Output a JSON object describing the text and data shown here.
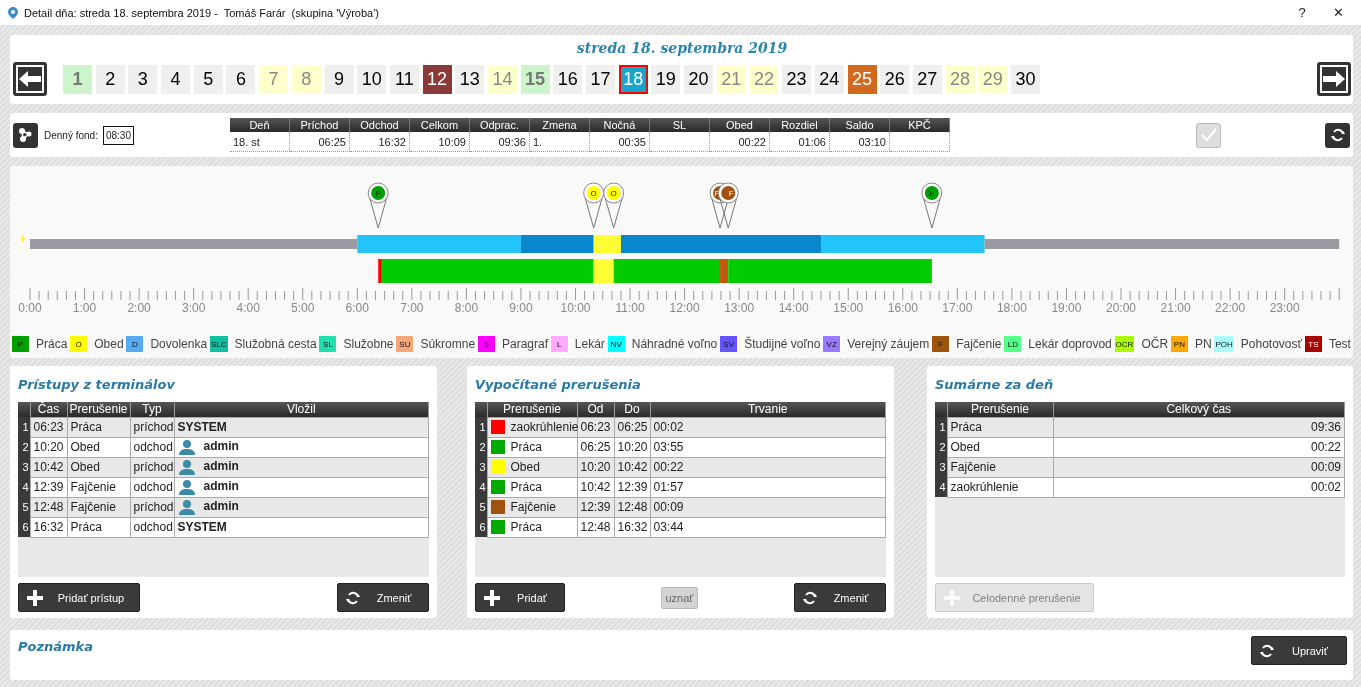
{
  "window": {
    "title": "Detail dňa: streda 18. septembra 2019 -  Tomáš Farár  (skupina 'Výroba')",
    "help": "?",
    "close": "✕"
  },
  "calendar": {
    "heading": "streda 18. septembra 2019",
    "days": [
      {
        "label": "1",
        "kind": "holiday",
        "selected": false
      },
      {
        "label": "2",
        "kind": "workday",
        "selected": false
      },
      {
        "label": "3",
        "kind": "workday",
        "selected": false
      },
      {
        "label": "4",
        "kind": "workday",
        "selected": false
      },
      {
        "label": "5",
        "kind": "workday",
        "selected": false
      },
      {
        "label": "6",
        "kind": "workday",
        "selected": false
      },
      {
        "label": "7",
        "kind": "weekend",
        "selected": false
      },
      {
        "label": "8",
        "kind": "weekend",
        "selected": false
      },
      {
        "label": "9",
        "kind": "workday",
        "selected": false
      },
      {
        "label": "10",
        "kind": "workday",
        "selected": false
      },
      {
        "label": "11",
        "kind": "workday",
        "selected": false
      },
      {
        "label": "12",
        "kind": "absence",
        "selected": false
      },
      {
        "label": "13",
        "kind": "workday",
        "selected": false
      },
      {
        "label": "14",
        "kind": "weekend",
        "selected": false
      },
      {
        "label": "15",
        "kind": "holiday",
        "selected": false
      },
      {
        "label": "16",
        "kind": "workday",
        "selected": false
      },
      {
        "label": "17",
        "kind": "workday",
        "selected": false
      },
      {
        "label": "18",
        "kind": "workday",
        "selected": true
      },
      {
        "label": "19",
        "kind": "workday",
        "selected": false
      },
      {
        "label": "20",
        "kind": "workday",
        "selected": false
      },
      {
        "label": "21",
        "kind": "weekend",
        "selected": false
      },
      {
        "label": "22",
        "kind": "weekend",
        "selected": false
      },
      {
        "label": "23",
        "kind": "workday",
        "selected": false
      },
      {
        "label": "24",
        "kind": "workday",
        "selected": false
      },
      {
        "label": "25",
        "kind": "vacation",
        "selected": false
      },
      {
        "label": "26",
        "kind": "workday",
        "selected": false
      },
      {
        "label": "27",
        "kind": "workday",
        "selected": false
      },
      {
        "label": "28",
        "kind": "weekend",
        "selected": false
      },
      {
        "label": "29",
        "kind": "weekend",
        "selected": false
      },
      {
        "label": "30",
        "kind": "workday",
        "selected": false
      }
    ]
  },
  "day_info": {
    "fund_label": "Denný fond:",
    "fund_value": "08:30",
    "columns": [
      {
        "header": "Deň",
        "value": "18. st"
      },
      {
        "header": "Príchod",
        "value": "06:25"
      },
      {
        "header": "Odchod",
        "value": "16:32"
      },
      {
        "header": "Celkom",
        "value": "10:09"
      },
      {
        "header": "Odprac.",
        "value": "09:36"
      },
      {
        "header": "Zmena",
        "value": "1."
      },
      {
        "header": "Nočná",
        "value": "00:35"
      },
      {
        "header": "SL"
      },
      {
        "header": "Obed",
        "value": "00:22"
      },
      {
        "header": "Rozdiel",
        "value": "01:06"
      },
      {
        "header": "Saldo",
        "value": "03:10"
      },
      {
        "header": "KPČ"
      }
    ],
    "confirm_disabled": true
  },
  "timeline": {
    "markers": [
      {
        "code": "P",
        "color": "#00a000"
      },
      {
        "code": "O",
        "color": "#ffff00"
      },
      {
        "code": "O",
        "color": "#ffff00"
      },
      {
        "code": "F",
        "color": "#a0520f"
      },
      {
        "code": "F",
        "color": "#a0520f"
      },
      {
        "code": "P",
        "color": "#00a000"
      }
    ],
    "shift_segments": [
      {
        "kind": "idle",
        "color": "#9a9aa2"
      },
      {
        "kind": "shift",
        "color": "#22c4fa"
      },
      {
        "kind": "shift",
        "color": "#0a86cc"
      },
      {
        "kind": "shift",
        "color": "#ffff33"
      },
      {
        "kind": "shift",
        "color": "#0a86cc"
      },
      {
        "kind": "shift",
        "color": "#22c4fa"
      },
      {
        "kind": "idle",
        "color": "#9a9aa2"
      }
    ],
    "work_segments": [
      {
        "color": "#ff0000"
      },
      {
        "color": "#00cc00"
      },
      {
        "color": "#ffff33"
      },
      {
        "color": "#00cc00"
      },
      {
        "color": "#c0580f"
      },
      {
        "color": "#00cc00"
      }
    ],
    "axis_labels": [
      "0:00",
      "1:00",
      "2:00",
      "3:00",
      "4:00",
      "5:00",
      "6:00",
      "7:00",
      "8:00",
      "9:00",
      "10:00",
      "11:00",
      "12:00",
      "13:00",
      "14:00",
      "15:00",
      "16:00",
      "17:00",
      "18:00",
      "19:00",
      "20:00",
      "21:00",
      "22:00",
      "23:00"
    ]
  },
  "legend": [
    {
      "code": "P",
      "label": "Práca",
      "color": "#00a000"
    },
    {
      "code": "O",
      "label": "Obed",
      "color": "#ffff00"
    },
    {
      "code": "D",
      "label": "Dovolenka",
      "color": "#55aaf0"
    },
    {
      "code": "SLC",
      "label": "Služobná cesta",
      "color": "#10c0a0"
    },
    {
      "code": "SL",
      "label": "Služobne",
      "color": "#20e0b0"
    },
    {
      "code": "SU",
      "label": "Súkromne",
      "color": "#f5a77a"
    },
    {
      "code": "§",
      "label": "Paragraf",
      "color": "#ff00ff"
    },
    {
      "code": "L",
      "label": "Lekár",
      "color": "#ffaaff"
    },
    {
      "code": "NV",
      "label": "Náhradné voľno",
      "color": "#00ffff"
    },
    {
      "code": "SV",
      "label": "Študijné voľno",
      "color": "#6655ff"
    },
    {
      "code": "VZ",
      "label": "Verejný záujem",
      "color": "#9a77ff"
    },
    {
      "code": "F",
      "label": "Fajčenie",
      "color": "#a0520f"
    },
    {
      "code": "LD",
      "label": "Lekár doprovod",
      "color": "#55ff88"
    },
    {
      "code": "OCR",
      "label": "OČR",
      "color": "#aaff00"
    },
    {
      "code": "PN",
      "label": "PN",
      "color": "#ffaa00"
    },
    {
      "code": "POH",
      "label": "Pohotovosť",
      "color": "#aaffff"
    },
    {
      "code": "TS",
      "label": "Test",
      "color": "#aa0000"
    }
  ],
  "terminal_access": {
    "title": "Prístupy z terminálov",
    "columns": [
      "Čas",
      "Prerušenie",
      "Typ",
      "Vložil"
    ],
    "rows": [
      {
        "n": "1",
        "time": "06:23",
        "break": "Práca",
        "type": "príchod",
        "by": "SYSTEM",
        "kind": "system"
      },
      {
        "n": "2",
        "time": "10:20",
        "break": "Obed",
        "type": "odchod",
        "by": "admin",
        "kind": "user"
      },
      {
        "n": "3",
        "time": "10:42",
        "break": "Obed",
        "type": "príchod",
        "by": "admin",
        "kind": "user"
      },
      {
        "n": "4",
        "time": "12:39",
        "break": "Fajčenie",
        "type": "odchod",
        "by": "admin",
        "kind": "user"
      },
      {
        "n": "5",
        "time": "12:48",
        "break": "Fajčenie",
        "type": "príchod",
        "by": "admin",
        "kind": "user"
      },
      {
        "n": "6",
        "time": "16:32",
        "break": "Práca",
        "type": "odchod",
        "by": "SYSTEM",
        "kind": "system"
      }
    ],
    "buttons": [
      {
        "label": "Pridať prístup",
        "disabled": false
      },
      {
        "label": "Zmeniť",
        "disabled": false
      }
    ]
  },
  "computed_breaks": {
    "title": "Vypočítané prerušenia",
    "columns": [
      "Prerušenie",
      "Od",
      "Do",
      "Trvanie"
    ],
    "rows": [
      {
        "n": "1",
        "break": "zaokrúhlenie",
        "color": "#ff0000",
        "from": "06:23",
        "to": "06:25",
        "duration": "00:02"
      },
      {
        "n": "2",
        "break": "Práca",
        "color": "#00aa00",
        "from": "06:25",
        "to": "10:20",
        "duration": "03:55"
      },
      {
        "n": "3",
        "break": "Obed",
        "color": "#ffff00",
        "from": "10:20",
        "to": "10:42",
        "duration": "00:22"
      },
      {
        "n": "4",
        "break": "Práca",
        "color": "#00aa00",
        "from": "10:42",
        "to": "12:39",
        "duration": "01:57"
      },
      {
        "n": "5",
        "break": "Fajčenie",
        "color": "#a0520f",
        "from": "12:39",
        "to": "12:48",
        "duration": "00:09"
      },
      {
        "n": "6",
        "break": "Práca",
        "color": "#00aa00",
        "from": "12:48",
        "to": "16:32",
        "duration": "03:44"
      }
    ],
    "buttons": [
      {
        "label": "Pridať",
        "disabled": false
      },
      {
        "label": "uznať",
        "disabled": true
      },
      {
        "label": "Zmeniť",
        "disabled": false
      }
    ]
  },
  "daily_summary": {
    "title": "Sumárne za deň",
    "columns": [
      "Prerušenie",
      "Celkový čas"
    ],
    "rows": [
      {
        "n": "1",
        "break": "Práca",
        "total": "09:36"
      },
      {
        "n": "2",
        "break": "Obed",
        "total": "00:22"
      },
      {
        "n": "3",
        "break": "Fajčenie",
        "total": "00:09"
      },
      {
        "n": "4",
        "break": "zaokrúhlenie",
        "total": "00:02"
      }
    ],
    "buttons": [
      {
        "label": "Celodenné prerušenie",
        "disabled": true
      }
    ]
  },
  "note": {
    "title": "Poznámka",
    "button": {
      "label": "Upraviť"
    }
  }
}
